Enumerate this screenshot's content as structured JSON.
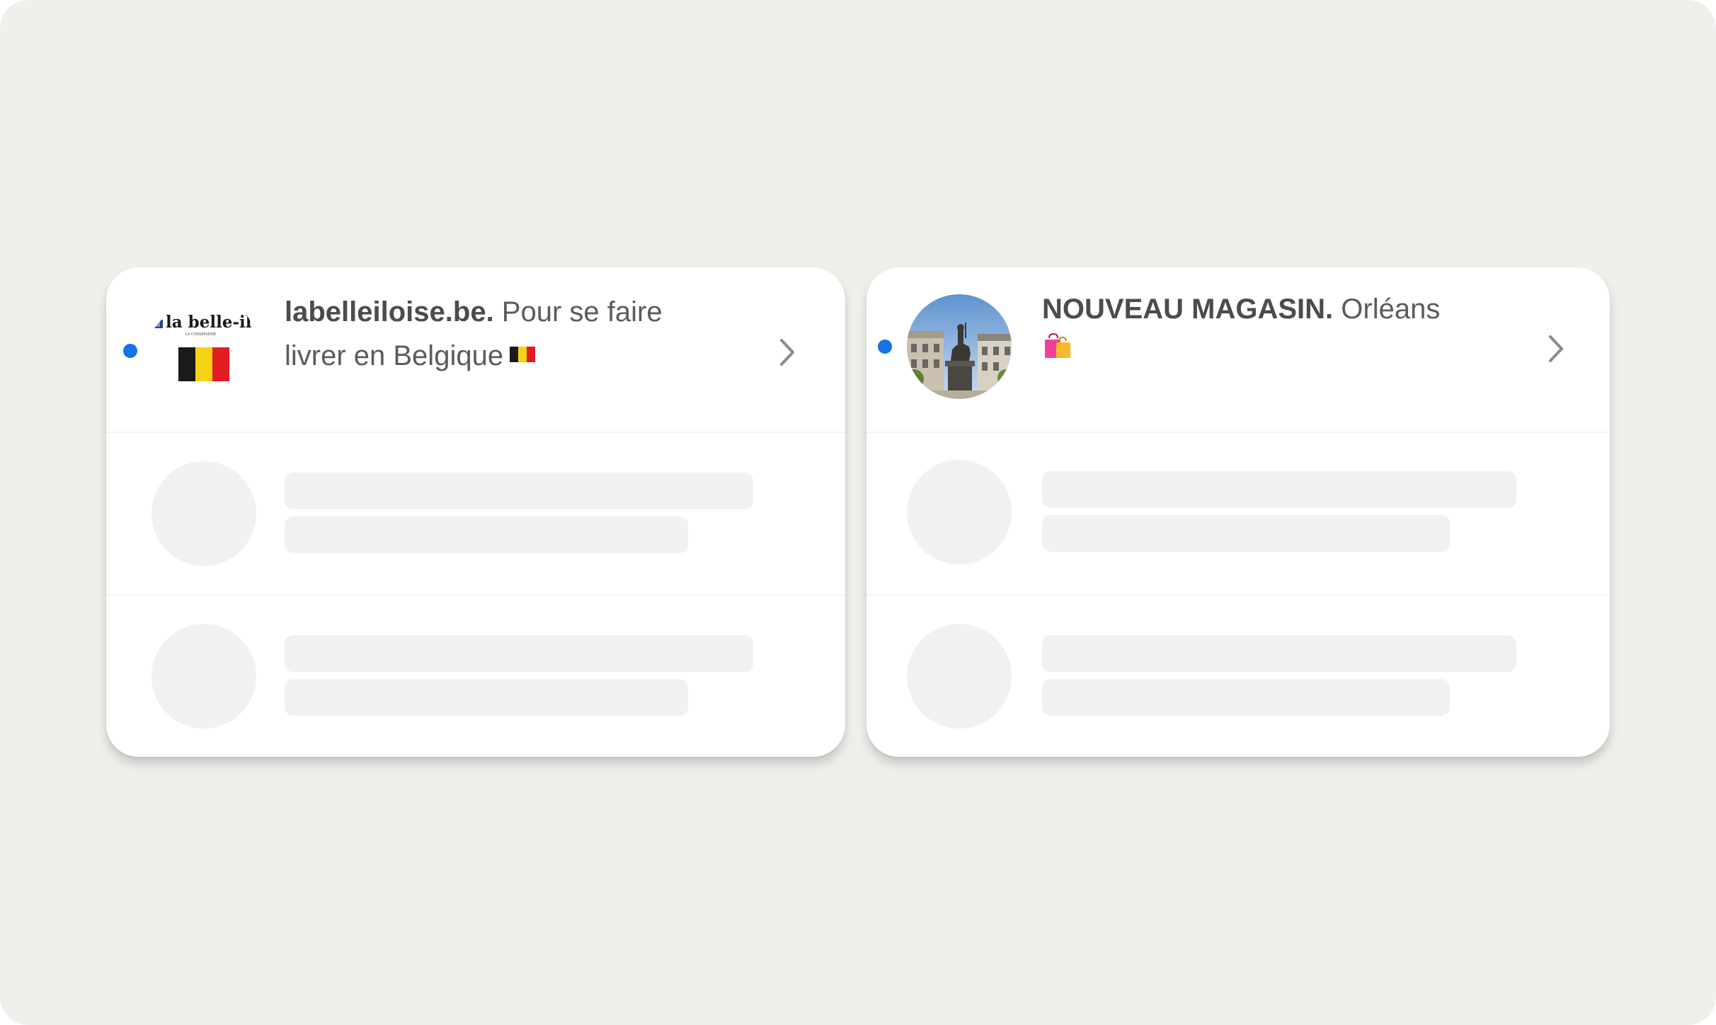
{
  "cards": [
    {
      "brand_logo_text": "la belle-iloise",
      "brand_logo_subtext": "LA CONSERVERIE",
      "title_bold": "labelleiloise.be.",
      "title_rest": " Pour se faire livrer en Belgique",
      "emoji": "belgium-flag-icon",
      "unread": true
    },
    {
      "title_bold": "NOUVEAU MAGASIN.",
      "title_rest": " Orléans",
      "emoji": "shopping-bags-icon",
      "unread": true
    }
  ],
  "colors": {
    "background": "#f0efec",
    "card": "#ffffff",
    "unread_dot": "#1473e6",
    "skeleton": "#f1f1f1",
    "text": "#5b5b5b"
  }
}
